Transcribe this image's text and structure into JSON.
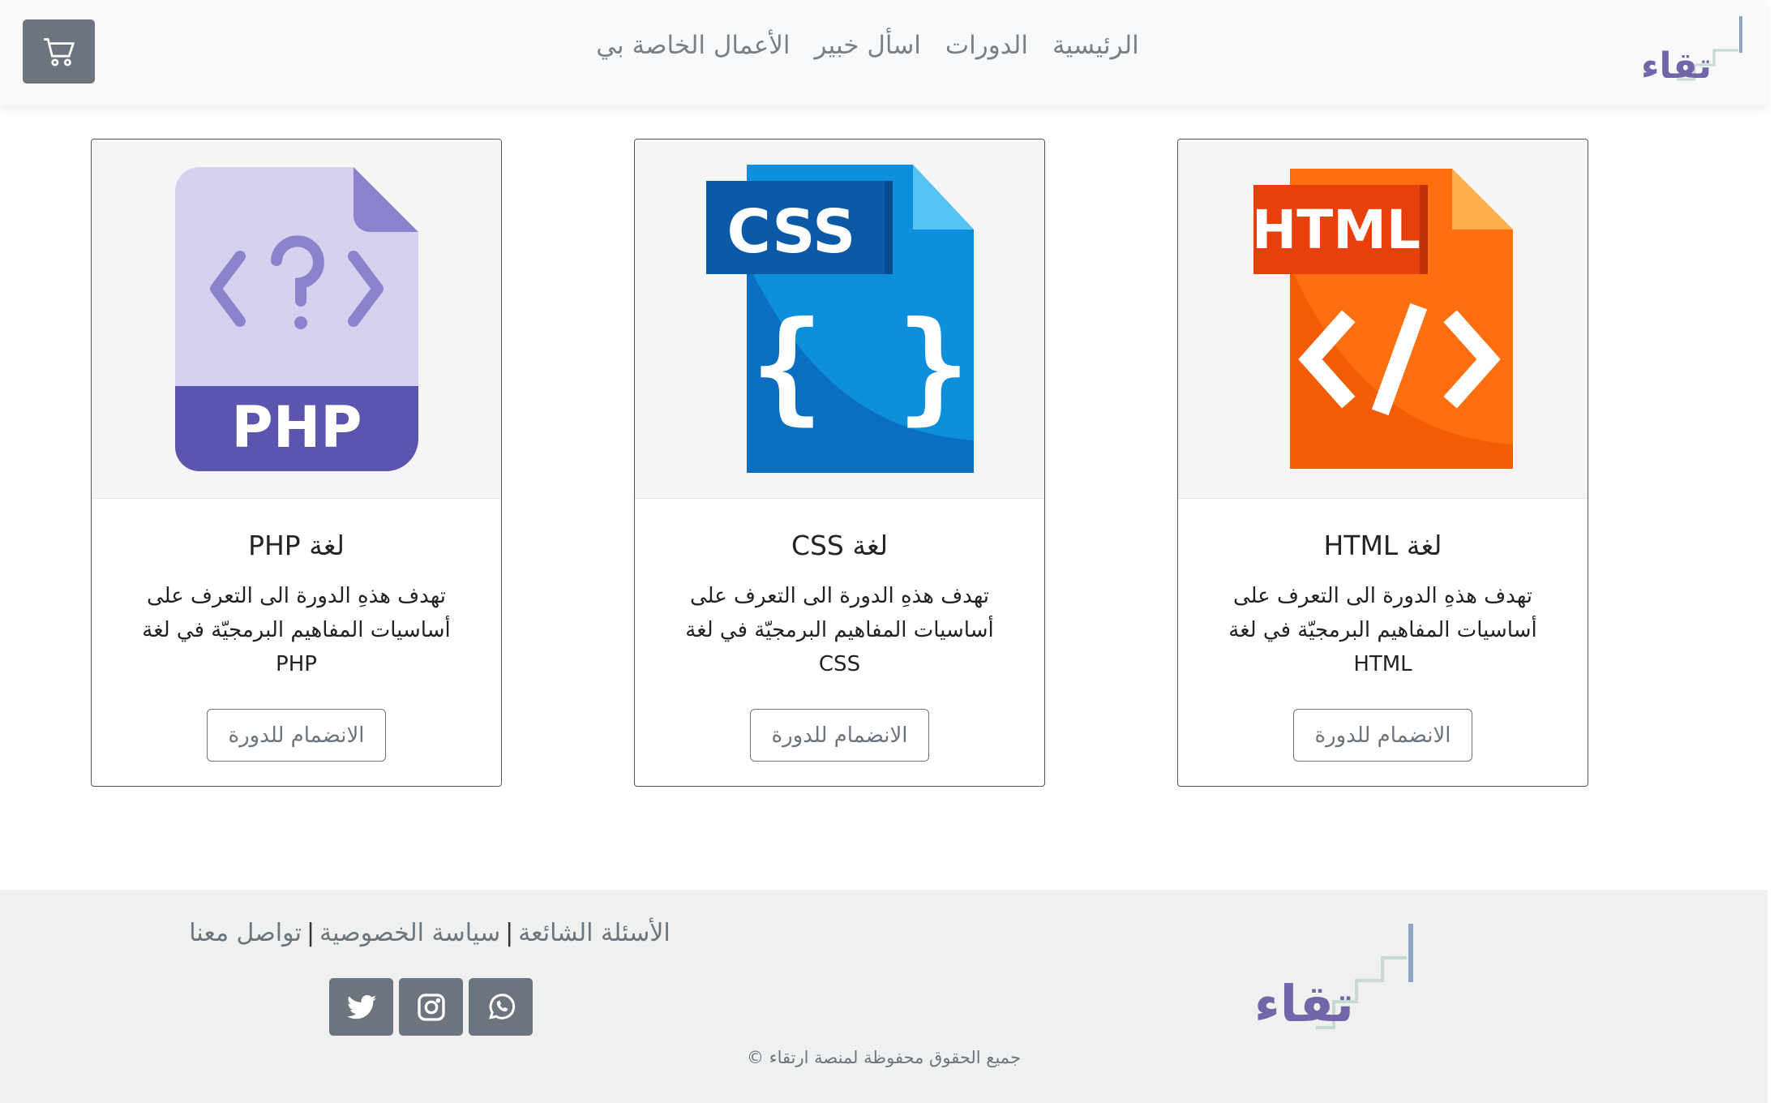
{
  "header": {
    "logo_text": "رتقاء",
    "cart_icon": "cart-icon",
    "nav": [
      "الرئيسية",
      "الدورات",
      "اسأل خبير",
      "الأعمال الخاصة بي"
    ]
  },
  "courses": [
    {
      "badge": "PHP",
      "title": "لغة PHP",
      "description": "تهدف هذهِ الدورة الى التعرف على أساسيات المفاهيم البرمجيّة في لغة PHP",
      "button": "الانضمام للدورة"
    },
    {
      "badge": "CSS",
      "title": "لغة CSS",
      "description": "تهدف هذهِ الدورة الى التعرف على أساسيات المفاهيم البرمجيّة في لغة CSS",
      "button": "الانضمام للدورة"
    },
    {
      "badge": "HTML",
      "title": "لغة HTML",
      "description": "تهدف هذهِ الدورة الى التعرف على أساسيات المفاهيم البرمجيّة في لغة HTML",
      "button": "الانضمام للدورة"
    }
  ],
  "footer": {
    "links": [
      "الأسئلة الشائعة",
      "سياسة الخصوصية",
      "تواصل معنا"
    ],
    "separator": "|",
    "social": [
      "whatsapp-icon",
      "instagram-icon",
      "twitter-icon"
    ],
    "copyright": "جميع الحقوق محفوظة لمنصة ارتقاء ©"
  },
  "colors": {
    "primary_gray": "#6c757d",
    "logo_purple": "#7265a8",
    "php": "#5b55b0",
    "css": "#0d8fdc",
    "html": "#ff6f0f"
  }
}
